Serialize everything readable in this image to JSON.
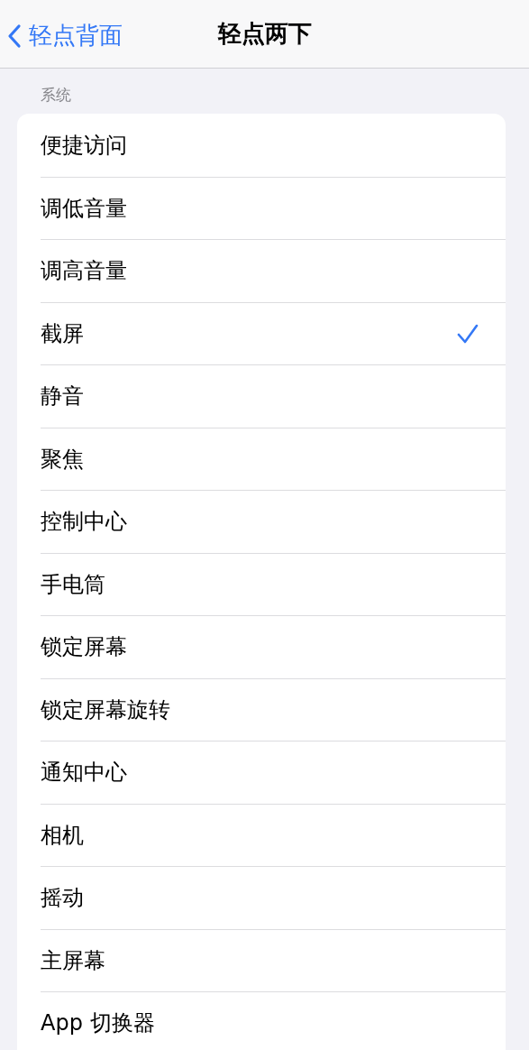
{
  "nav": {
    "back": "轻点背面",
    "title": "轻点两下"
  },
  "section": {
    "header": "系统",
    "items": [
      {
        "label": "便捷访问",
        "selected": false
      },
      {
        "label": "调低音量",
        "selected": false
      },
      {
        "label": "调高音量",
        "selected": false
      },
      {
        "label": "截屏",
        "selected": true
      },
      {
        "label": "静音",
        "selected": false
      },
      {
        "label": "聚焦",
        "selected": false
      },
      {
        "label": "控制中心",
        "selected": false
      },
      {
        "label": "手电筒",
        "selected": false
      },
      {
        "label": "锁定屏幕",
        "selected": false
      },
      {
        "label": "锁定屏幕旋转",
        "selected": false
      },
      {
        "label": "通知中心",
        "selected": false
      },
      {
        "label": "相机",
        "selected": false
      },
      {
        "label": "摇动",
        "selected": false
      },
      {
        "label": "主屏幕",
        "selected": false
      },
      {
        "label": "App 切换器",
        "selected": false
      }
    ]
  }
}
